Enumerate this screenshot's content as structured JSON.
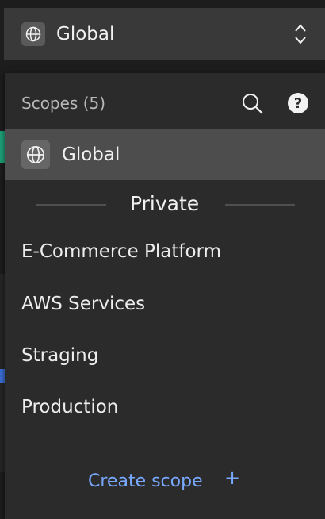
{
  "selector": {
    "icon": "globe-icon",
    "label": "Global",
    "chevron_icon": "chevron-up-down-icon"
  },
  "dropdown": {
    "title": "Scopes (5)",
    "search_icon": "search-icon",
    "help_icon": "help-icon",
    "help_glyph": "?",
    "selected_item": {
      "icon": "globe-icon",
      "label": "Global"
    },
    "section_label": "Private",
    "items": [
      {
        "label": "E-Commerce Platform"
      },
      {
        "label": "AWS Services"
      },
      {
        "label": "Straging"
      },
      {
        "label": "Production"
      }
    ],
    "create": {
      "label": "Create scope",
      "plus": "+"
    }
  },
  "colors": {
    "accent": "#78a9ff",
    "selected_row": "#4d4d4d",
    "panel": "#2b2b2b",
    "selector_bg": "#393939"
  }
}
